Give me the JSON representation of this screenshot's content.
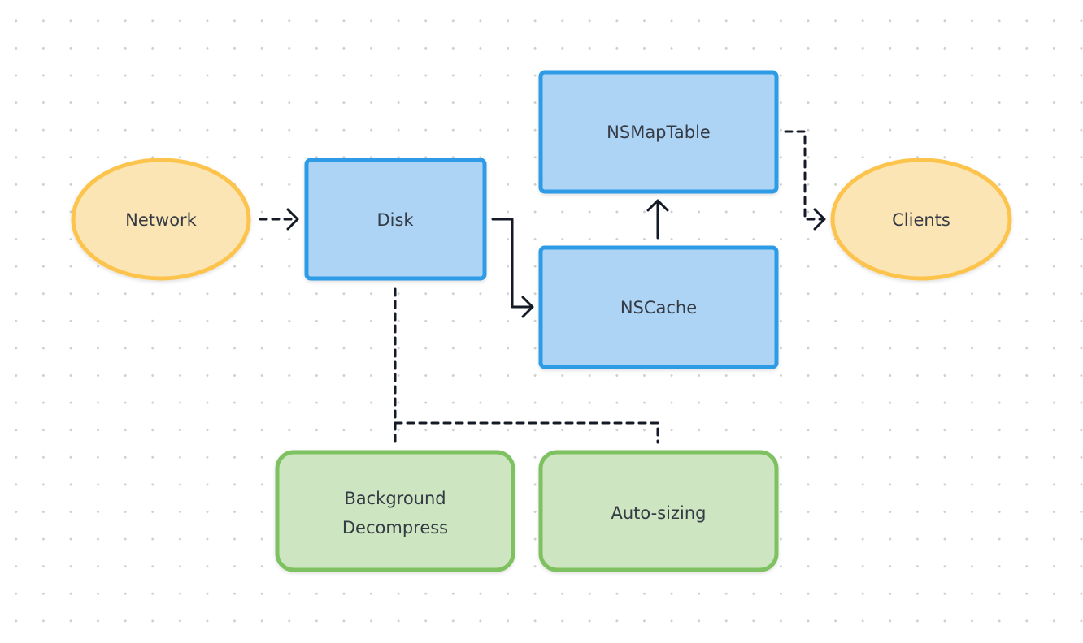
{
  "nodes": {
    "network": {
      "label": "Network",
      "shape": "ellipse",
      "fill": "#fce5b4",
      "stroke": "#fcc44e"
    },
    "disk": {
      "label": "Disk",
      "shape": "rectangle",
      "fill": "#aed4f5",
      "stroke": "#2f9be6"
    },
    "nsmaptable": {
      "label": "NSMapTable",
      "shape": "rectangle",
      "fill": "#aed4f5",
      "stroke": "#2f9be6"
    },
    "nscache": {
      "label": "NSCache",
      "shape": "rectangle",
      "fill": "#aed4f5",
      "stroke": "#2f9be6"
    },
    "clients": {
      "label": "Clients",
      "shape": "ellipse",
      "fill": "#fce5b4",
      "stroke": "#fcc44e"
    },
    "background_decompress": {
      "label_line1": "Background",
      "label_line2": "Decompress",
      "shape": "rounded-rectangle",
      "fill": "#cde5c0",
      "stroke": "#7dc160"
    },
    "auto_sizing": {
      "label": "Auto-sizing",
      "shape": "rounded-rectangle",
      "fill": "#cde5c0",
      "stroke": "#7dc160"
    }
  },
  "edges": [
    {
      "from": "Network",
      "to": "Disk",
      "style": "dashed",
      "arrow": true
    },
    {
      "from": "Disk",
      "to": "NSCache",
      "style": "solid",
      "arrow": true
    },
    {
      "from": "NSCache",
      "to": "NSMapTable",
      "style": "solid",
      "arrow": true
    },
    {
      "from": "NSMapTable",
      "to": "Clients",
      "style": "dashed",
      "arrow": true
    },
    {
      "from": "Disk",
      "to": "Background Decompress",
      "style": "dashed",
      "arrow": false
    },
    {
      "from": "Disk",
      "to": "Auto-sizing",
      "style": "dashed",
      "arrow": false
    }
  ],
  "colors": {
    "edge": "#141a26",
    "grid_dot": "#cfcfcf",
    "text": "#343a44"
  }
}
